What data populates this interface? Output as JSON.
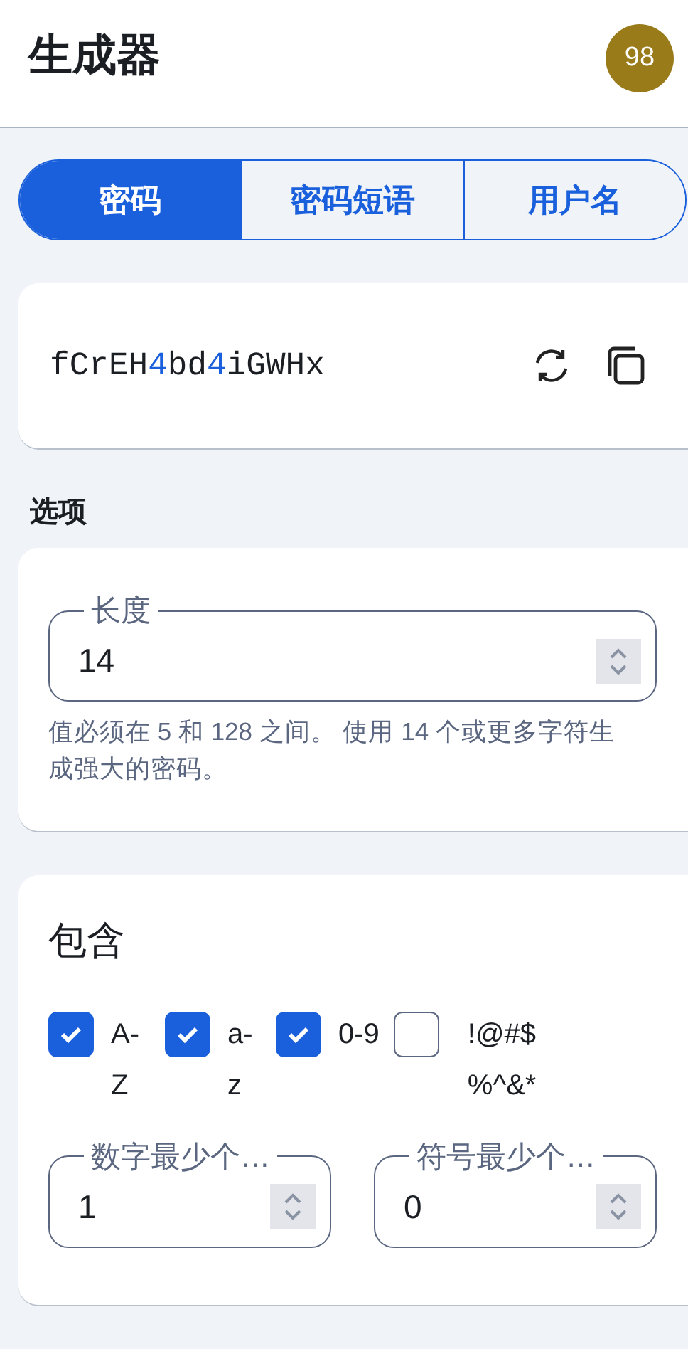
{
  "header": {
    "title": "生成器",
    "avatar": "98"
  },
  "tabs": [
    {
      "label": "密码",
      "selected": true
    },
    {
      "label": "密码短语",
      "selected": false
    },
    {
      "label": "用户名",
      "selected": false
    }
  ],
  "password": {
    "value": "fCrEH4bd4iGWHx"
  },
  "options_heading": "选项",
  "length_field": {
    "label": "长度",
    "value": "14",
    "hint": "值必须在 5 和 128 之间。 使用 14 个或更多字符生成强大的密码。"
  },
  "include": {
    "title": "包含",
    "options": [
      {
        "label": "A-Z",
        "checked": true
      },
      {
        "label": "a-z",
        "checked": true
      },
      {
        "label": "0-9",
        "checked": true
      },
      {
        "label": "!@#$%^&*",
        "checked": false
      }
    ],
    "min_fields": [
      {
        "label": "数字最少个…",
        "value": "1"
      },
      {
        "label": "符号最少个…",
        "value": "0"
      }
    ]
  }
}
